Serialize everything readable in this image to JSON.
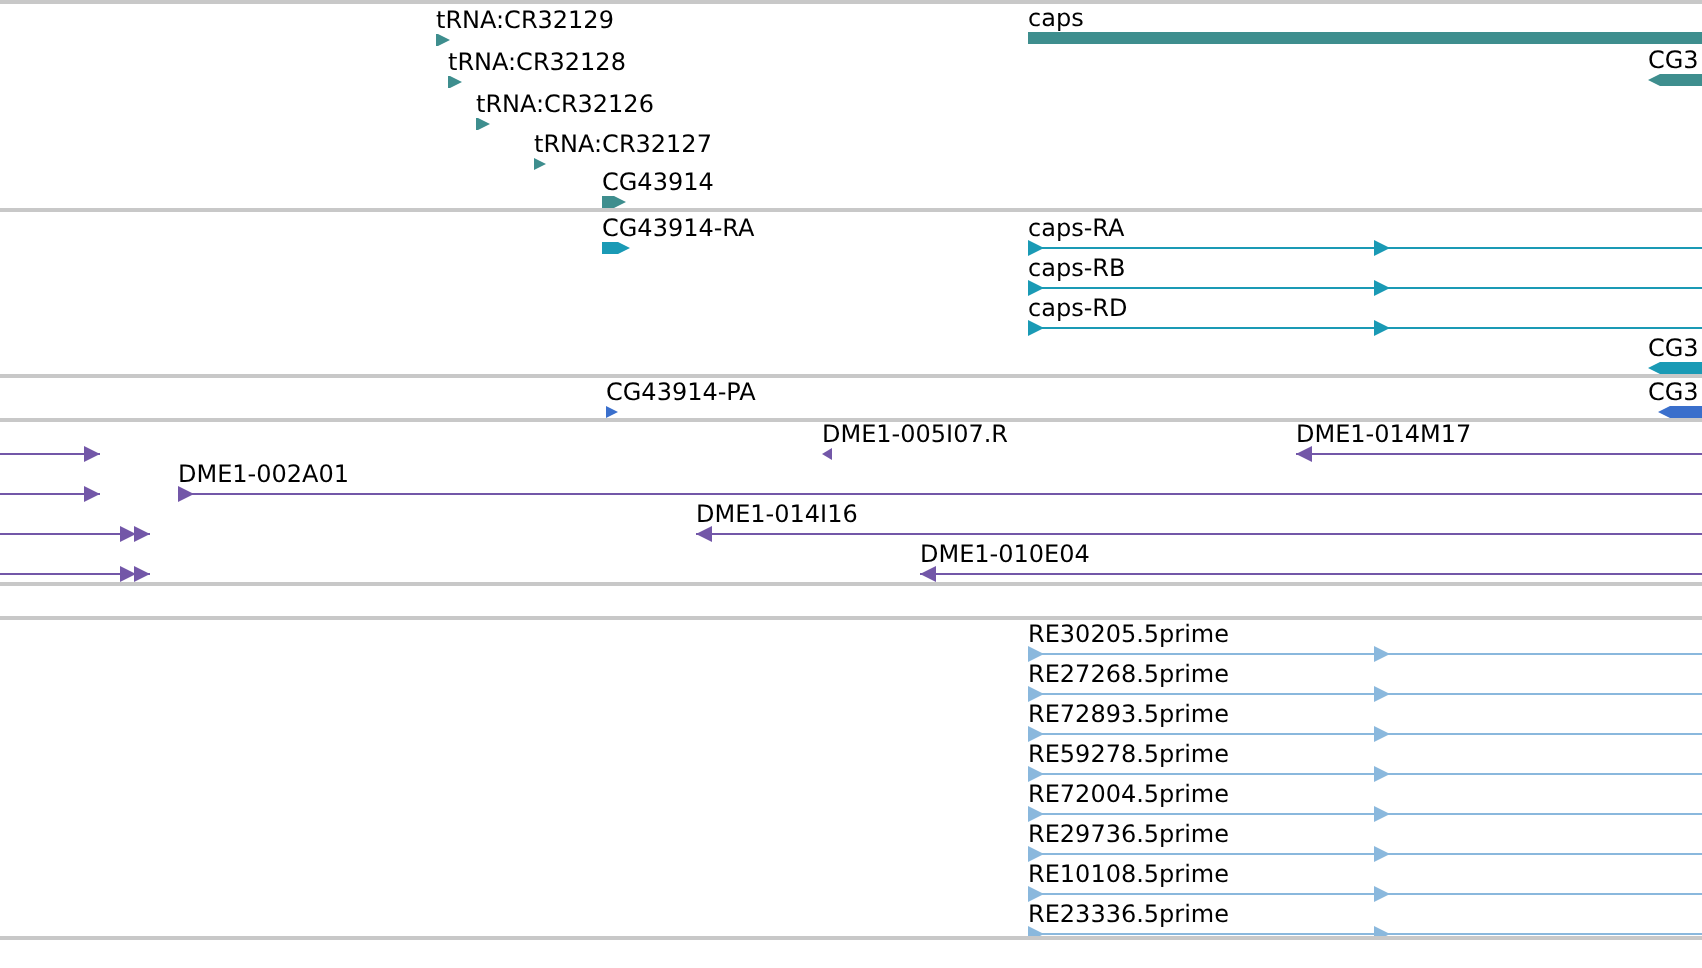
{
  "tracks": [
    {
      "color": "#3e8e8e",
      "features": [
        {
          "label": "tRNA:CR32129",
          "kind": "block",
          "reverse": false
        },
        {
          "label": "tRNA:CR32128",
          "kind": "block",
          "reverse": false
        },
        {
          "label": "tRNA:CR32126",
          "kind": "block",
          "reverse": false
        },
        {
          "label": "tRNA:CR32127",
          "kind": "block",
          "reverse": false
        },
        {
          "label": "CG43914",
          "kind": "block",
          "reverse": false
        },
        {
          "label": "caps",
          "kind": "bar"
        },
        {
          "label": "CG3",
          "kind": "block",
          "reverse": true
        }
      ]
    },
    {
      "color": "#1a9ab5",
      "features": [
        {
          "label": "CG43914-RA",
          "kind": "block",
          "reverse": false
        },
        {
          "label": "caps-RA",
          "kind": "line",
          "reverse": false
        },
        {
          "label": "caps-RB",
          "kind": "line",
          "reverse": false
        },
        {
          "label": "caps-RD",
          "kind": "line",
          "reverse": false
        },
        {
          "label": "CG3",
          "kind": "block",
          "reverse": true
        }
      ]
    },
    {
      "color": "#3a6fcc",
      "features": [
        {
          "label": "CG43914-PA",
          "kind": "block",
          "reverse": false
        },
        {
          "label": "CG3",
          "kind": "block",
          "reverse": true
        }
      ]
    },
    {
      "color": "#7357a8",
      "features": [
        {
          "kind": "line",
          "reverse": false
        },
        {
          "label": "DME1-005I07.R",
          "kind": "block",
          "reverse": true
        },
        {
          "label": "DME1-014M17",
          "kind": "line",
          "reverse": true
        },
        {
          "kind": "line",
          "reverse": false
        },
        {
          "label": "DME1-002A01",
          "kind": "line",
          "reverse": false
        },
        {
          "kind": "line",
          "reverse": false
        },
        {
          "label": "DME1-014I16",
          "kind": "line",
          "reverse": true
        },
        {
          "kind": "line",
          "reverse": false
        },
        {
          "label": "DME1-010E04",
          "kind": "line",
          "reverse": true
        }
      ]
    },
    {
      "color": "#8ab8dd",
      "features": [
        {
          "label": "RE30205.5prime",
          "kind": "line",
          "reverse": false
        },
        {
          "label": "RE27268.5prime",
          "kind": "line",
          "reverse": false
        },
        {
          "label": "RE72893.5prime",
          "kind": "line",
          "reverse": false
        },
        {
          "label": "RE59278.5prime",
          "kind": "line",
          "reverse": false
        },
        {
          "label": "RE72004.5prime",
          "kind": "line",
          "reverse": false
        },
        {
          "label": "RE29736.5prime",
          "kind": "line",
          "reverse": false
        },
        {
          "label": "RE10108.5prime",
          "kind": "line",
          "reverse": false
        },
        {
          "label": "RE23336.5prime",
          "kind": "line",
          "reverse": false
        }
      ]
    }
  ]
}
